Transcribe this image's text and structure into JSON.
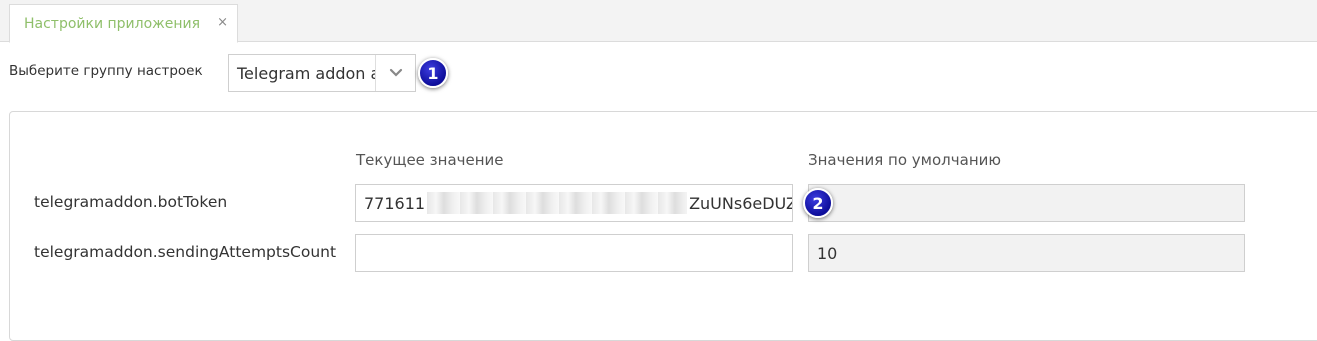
{
  "tab": {
    "label": "Настройки приложения",
    "close_glyph": "×"
  },
  "group": {
    "label": "Выберите группу настроек",
    "selected": "Telegram addon a",
    "arrow_icon": "chevron-down-icon"
  },
  "badges": {
    "first": "1",
    "second": "2"
  },
  "columns": {
    "current": "Текущее значение",
    "default": "Значения по умолчанию"
  },
  "rows": [
    {
      "key": "telegramaddon.botToken",
      "current_prefix": "771611",
      "current_suffix": "ZuUNs6eDUZ",
      "default": ""
    },
    {
      "key": "telegramaddon.sendingAttemptsCount",
      "current": "",
      "default": "10"
    }
  ],
  "colors": {
    "tab_label": "#8fbf6a",
    "badge": "#1a1ab8",
    "readonly_field": "#f2f2f2"
  }
}
